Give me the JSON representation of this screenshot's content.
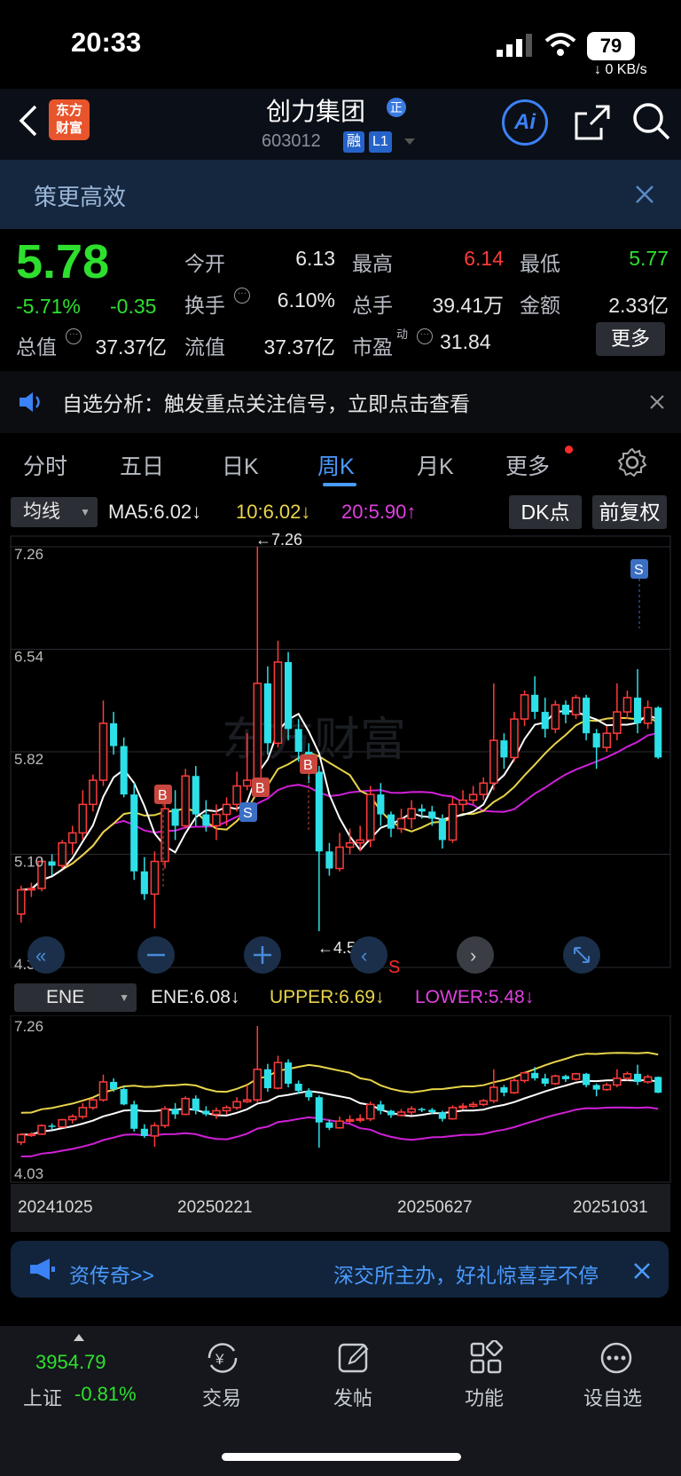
{
  "status_bar": {
    "time": "20:33",
    "battery": "79",
    "net_speed": "↓ 0 KB/s"
  },
  "header": {
    "app_logo_text": [
      "东方",
      "财富"
    ],
    "title": "创力集团",
    "title_badge": "正",
    "stock_code": "603012",
    "tags": [
      "融",
      "L1"
    ],
    "ai_label": "Ai"
  },
  "banner": {
    "text": "策更高效"
  },
  "quote": {
    "price": "5.78",
    "change_pct": "-5.71%",
    "change": "-0.35",
    "fields": [
      {
        "label": "今开",
        "value": "6.13",
        "color": "#e8e8e8"
      },
      {
        "label": "最高",
        "value": "6.14",
        "color": "#ff3b3b"
      },
      {
        "label": "最低",
        "value": "5.77",
        "color": "#2ee02e"
      },
      {
        "label": "换手",
        "value": "6.10%",
        "color": "#e8e8e8"
      },
      {
        "label": "总手",
        "value": "39.41万",
        "color": "#e8e8e8"
      },
      {
        "label": "金额",
        "value": "2.33亿",
        "color": "#e8e8e8"
      },
      {
        "label": "总值",
        "value": "37.37亿",
        "color": "#e8e8e8"
      },
      {
        "label": "流值",
        "value": "37.37亿",
        "color": "#e8e8e8"
      },
      {
        "label": "市盈",
        "label_sup": "动",
        "value": "31.84",
        "color": "#e8e8e8"
      }
    ],
    "more_button": "更多"
  },
  "notice": {
    "text": "自选分析：触发重点关注信号，立即点击查看"
  },
  "tabs": [
    "分时",
    "五日",
    "日K",
    "周K",
    "月K",
    "更多"
  ],
  "active_tab": "周K",
  "ma_bar": {
    "selector": "均线",
    "ma5": "MA5:6.02↓",
    "ma10": "10:6.02↓",
    "ma20": "20:5.90↑",
    "dk_button": "DK点",
    "adjust_button": "前复权"
  },
  "main_chart": {
    "y_labels": [
      "7.26",
      "6.54",
      "5.82",
      "5.10",
      "4.38"
    ],
    "high_label": "←7.26",
    "low_label": "←4.56",
    "markers": [
      "B",
      "B",
      "B",
      "S",
      "S"
    ],
    "s_label": "S"
  },
  "ene_bar": {
    "selector": "ENE",
    "ene": "ENE:6.08↓",
    "upper": "UPPER:6.69↓",
    "lower": "LOWER:5.48↓"
  },
  "ene_chart": {
    "y_labels": [
      "7.26",
      "4.03"
    ],
    "dates": [
      "20241025",
      "20250221",
      "20250627",
      "20251031"
    ]
  },
  "ad_bar": {
    "left_text": "资传奇>>",
    "right_text": "深交所主办，好礼惊喜享不停"
  },
  "bottom_nav": {
    "index_value": "3954.79",
    "index_name": "上证",
    "index_change": "-0.81%",
    "items": [
      "交易",
      "发帖",
      "功能",
      "设自选"
    ]
  },
  "chart_data": {
    "type": "candlestick",
    "period": "weekly",
    "ylim": [
      4.38,
      7.26
    ],
    "candles": [
      [
        4.68,
        4.85,
        4.62,
        4.88
      ],
      [
        4.85,
        4.86,
        4.8,
        4.9
      ],
      [
        4.86,
        5.05,
        4.84,
        5.08
      ],
      [
        5.05,
        5.02,
        4.95,
        5.1
      ],
      [
        5.02,
        5.18,
        5.0,
        5.2
      ],
      [
        5.18,
        5.25,
        5.1,
        5.3
      ],
      [
        5.25,
        5.45,
        5.2,
        5.55
      ],
      [
        5.45,
        5.62,
        5.4,
        5.66
      ],
      [
        5.62,
        6.02,
        5.58,
        6.18
      ],
      [
        6.02,
        5.86,
        5.8,
        6.1
      ],
      [
        5.86,
        5.52,
        5.5,
        5.92
      ],
      [
        5.52,
        4.98,
        4.92,
        5.6
      ],
      [
        4.98,
        4.82,
        4.78,
        5.08
      ],
      [
        4.82,
        5.05,
        4.58,
        5.12
      ],
      [
        5.05,
        5.42,
        5.0,
        5.48
      ],
      [
        5.42,
        5.3,
        5.2,
        5.55
      ],
      [
        5.3,
        5.65,
        5.28,
        5.7
      ],
      [
        5.65,
        5.38,
        5.3,
        5.72
      ],
      [
        5.38,
        5.3,
        5.26,
        5.48
      ],
      [
        5.3,
        5.38,
        5.2,
        5.45
      ],
      [
        5.38,
        5.45,
        5.3,
        5.5
      ],
      [
        5.45,
        5.58,
        5.4,
        5.68
      ],
      [
        5.58,
        5.62,
        5.55,
        5.95
      ],
      [
        5.62,
        6.3,
        5.55,
        7.26
      ],
      [
        6.3,
        5.88,
        5.8,
        6.42
      ],
      [
        5.88,
        6.45,
        5.85,
        6.6
      ],
      [
        6.45,
        5.98,
        5.9,
        6.52
      ],
      [
        5.98,
        5.82,
        5.75,
        6.05
      ],
      [
        5.82,
        5.68,
        5.6,
        5.88
      ],
      [
        5.68,
        5.12,
        4.56,
        5.72
      ],
      [
        5.12,
        5.0,
        4.95,
        5.18
      ],
      [
        5.0,
        5.15,
        4.98,
        5.25
      ],
      [
        5.15,
        5.18,
        5.1,
        5.28
      ],
      [
        5.18,
        5.2,
        5.12,
        5.3
      ],
      [
        5.2,
        5.52,
        5.15,
        5.58
      ],
      [
        5.52,
        5.38,
        5.3,
        5.6
      ],
      [
        5.38,
        5.28,
        5.22,
        5.4
      ],
      [
        5.28,
        5.35,
        5.25,
        5.42
      ],
      [
        5.35,
        5.42,
        5.28,
        5.48
      ],
      [
        5.42,
        5.4,
        5.35,
        5.45
      ],
      [
        5.4,
        5.35,
        5.3,
        5.44
      ],
      [
        5.35,
        5.2,
        5.14,
        5.38
      ],
      [
        5.2,
        5.45,
        5.18,
        5.5
      ],
      [
        5.45,
        5.48,
        5.4,
        5.55
      ],
      [
        5.48,
        5.52,
        5.45,
        5.58
      ],
      [
        5.52,
        5.6,
        5.48,
        5.64
      ],
      [
        5.6,
        5.9,
        5.55,
        6.3
      ],
      [
        5.9,
        5.78,
        5.7,
        5.95
      ],
      [
        5.78,
        6.05,
        5.75,
        6.1
      ],
      [
        6.05,
        6.22,
        6.0,
        6.25
      ],
      [
        6.22,
        6.1,
        6.05,
        6.35
      ],
      [
        6.1,
        5.98,
        5.92,
        6.2
      ],
      [
        5.98,
        6.15,
        5.95,
        6.18
      ],
      [
        6.15,
        6.08,
        6.02,
        6.18
      ],
      [
        6.08,
        6.2,
        6.05,
        6.22
      ],
      [
        6.2,
        5.95,
        5.9,
        6.22
      ],
      [
        5.95,
        5.85,
        5.7,
        5.98
      ],
      [
        5.85,
        5.95,
        5.82,
        6.0
      ],
      [
        5.95,
        6.1,
        5.9,
        6.3
      ],
      [
        6.1,
        6.2,
        6.05,
        6.25
      ],
      [
        6.2,
        6.02,
        5.95,
        6.4
      ],
      [
        6.02,
        6.13,
        5.98,
        6.18
      ],
      [
        6.13,
        5.78,
        5.77,
        6.14
      ]
    ],
    "candle_fields": [
      "open",
      "close",
      "low",
      "high"
    ]
  }
}
